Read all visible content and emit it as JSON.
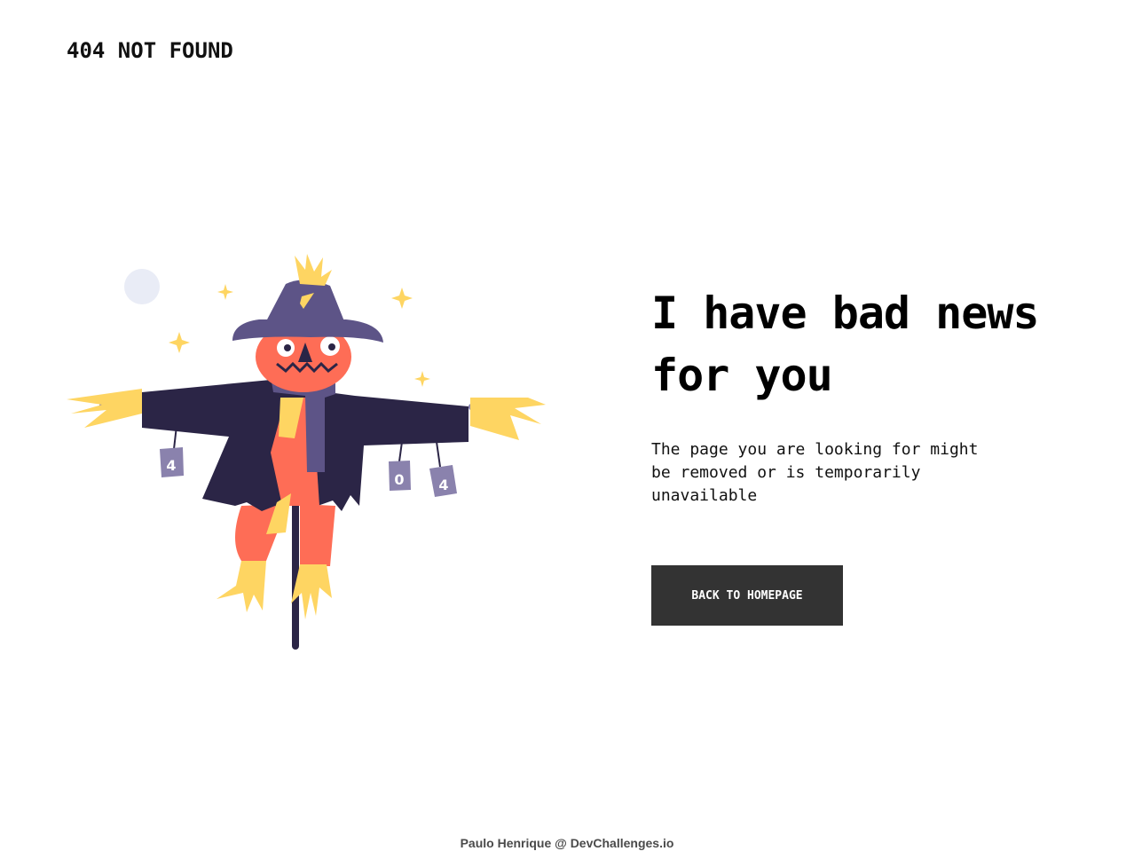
{
  "header": {
    "brand": "404 NOT FOUND"
  },
  "main": {
    "headline_line1": "I have bad news",
    "headline_line2": "for you",
    "message": "The page you are looking for might be removed or is temporarily unavailable",
    "cta_label": "BACK TO HOMEPAGE"
  },
  "illustration": {
    "cans": [
      "4",
      "0",
      "4"
    ],
    "icons": [
      "scarecrow-icon",
      "moon-icon",
      "sparkle-icon"
    ]
  },
  "footer": {
    "credit": "Paulo Henrique @ DevChallenges.io"
  },
  "colors": {
    "background": "#ffffff",
    "button": "#333333",
    "hat": "#5d5487",
    "coat": "#2b2546",
    "skin": "#fe6d56",
    "straw": "#fed562",
    "can": "#8a82ad",
    "moon": "#e9ecf6"
  }
}
